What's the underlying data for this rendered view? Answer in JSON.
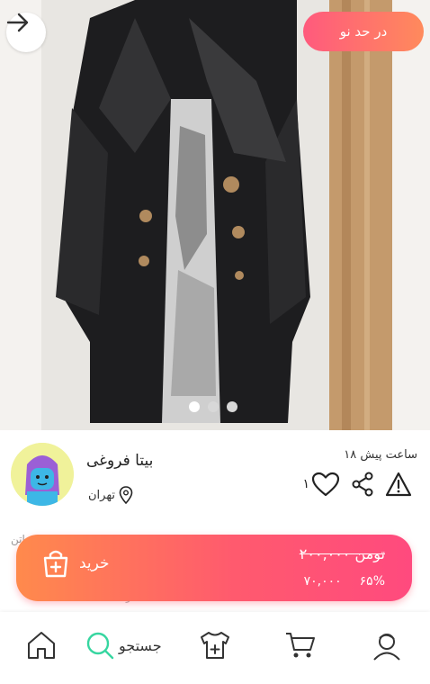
{
  "photo": {
    "condition_badge": "در حد نو",
    "slide_count": 3,
    "active_slide": 1
  },
  "seller": {
    "name": "بیتا فروغی",
    "location": "تهران"
  },
  "listing": {
    "time_ago": "۱۸ ساعت پیش",
    "like_count": "۱",
    "description_peek": "ساتن",
    "description_peek2": "ژ"
  },
  "buy_bar": {
    "buy_label": "خرید",
    "original_price": "۲۰۰,۰۰۰ تومن",
    "discount_percent": "۶۵%",
    "final_price": "۷۰,۰۰۰"
  },
  "nav": {
    "search_label": "جستجو"
  },
  "colors": {
    "accent_start": "#ff8a4c",
    "accent_end": "#ff4a7e",
    "search_green": "#36d6a0"
  }
}
